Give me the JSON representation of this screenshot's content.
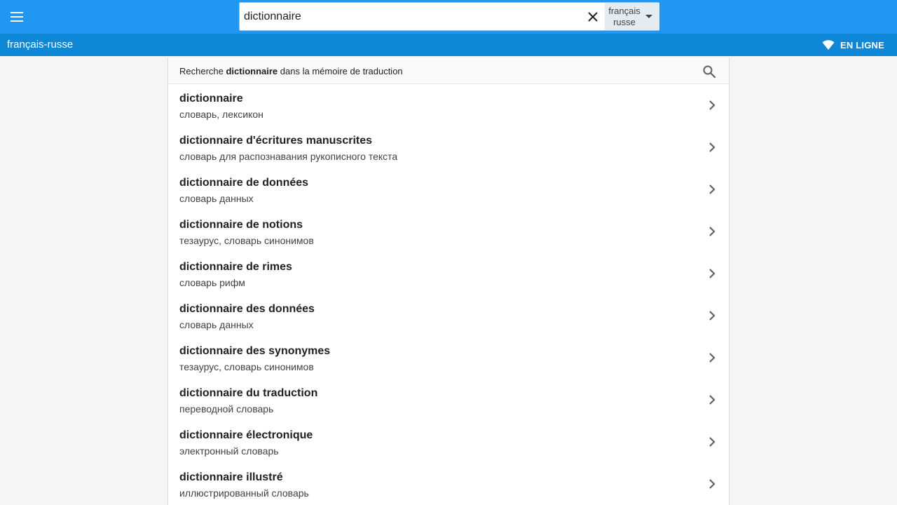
{
  "header": {
    "menu_icon": "menu-icon",
    "search": {
      "value": "dictionnaire",
      "placeholder": "",
      "clear_icon": "close-icon"
    },
    "language": {
      "source": "français",
      "target": "russe",
      "caret_icon": "caret-down-icon"
    },
    "colors": {
      "appbar": "#2196f3",
      "subbar": "#0d87d6"
    }
  },
  "subbar": {
    "title": "français-russe",
    "status_label": "EN LIGNE",
    "status_icon": "wifi-icon"
  },
  "memory_search": {
    "prefix": "Recherche ",
    "term": "dictionnaire",
    "suffix": " dans la mémoire de traduction",
    "icon": "search-icon"
  },
  "results": [
    {
      "term": "dictionnaire",
      "translation": "словарь, лексикон"
    },
    {
      "term": "dictionnaire d'écritures manuscrites",
      "translation": "словарь для распознавания рукописного текста"
    },
    {
      "term": "dictionnaire de données",
      "translation": "словарь данных"
    },
    {
      "term": "dictionnaire de notions",
      "translation": "тезаурус, словарь синонимов"
    },
    {
      "term": "dictionnaire de rimes",
      "translation": "словарь рифм"
    },
    {
      "term": "dictionnaire des données",
      "translation": "словарь данных"
    },
    {
      "term": "dictionnaire des synonymes",
      "translation": "тезаурус, словарь синонимов"
    },
    {
      "term": "dictionnaire du traduction",
      "translation": "переводной словарь"
    },
    {
      "term": "dictionnaire électronique",
      "translation": "электронный словарь"
    },
    {
      "term": "dictionnaire illustré",
      "translation": "иллюстрированный словарь"
    }
  ]
}
